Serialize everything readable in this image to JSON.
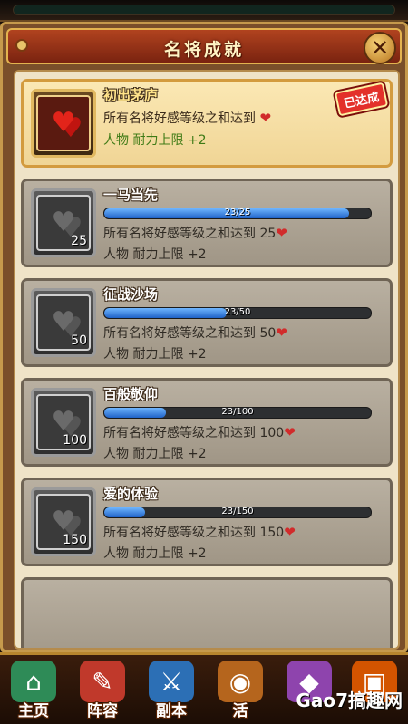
{
  "header": {
    "title": "名将成就",
    "close_label": "✕"
  },
  "achievements": [
    {
      "name": "初出茅庐",
      "desc": "所有名将好感等级之和达到",
      "target": "",
      "reward": "人物 耐力上限 +2",
      "status_stamp": "已达成",
      "progress_text": "",
      "progress": 1.0,
      "completed": true
    },
    {
      "name": "一马当先",
      "desc": "所有名将好感等级之和达到",
      "target": "25",
      "reward": "人物 耐力上限 +2",
      "progress_text": "23/25",
      "progress": 0.92,
      "badge_num": "25",
      "completed": false
    },
    {
      "name": "征战沙场",
      "desc": "所有名将好感等级之和达到",
      "target": "50",
      "reward": "人物 耐力上限 +2",
      "progress_text": "23/50",
      "progress": 0.46,
      "badge_num": "50",
      "completed": false
    },
    {
      "name": "百般敬仰",
      "desc": "所有名将好感等级之和达到",
      "target": "100",
      "reward": "人物 耐力上限 +2",
      "progress_text": "23/100",
      "progress": 0.23,
      "badge_num": "100",
      "completed": false
    },
    {
      "name": "爱的体验",
      "desc": "所有名将好感等级之和达到",
      "target": "150",
      "reward": "人物 耐力上限 +2",
      "progress_text": "23/150",
      "progress": 0.153,
      "badge_num": "150",
      "completed": false
    }
  ],
  "nav": [
    {
      "label": "主页",
      "icon": "home-icon",
      "color": "#2e8b57"
    },
    {
      "label": "阵容",
      "icon": "scroll-icon",
      "color": "#c0392b"
    },
    {
      "label": "副本",
      "icon": "sword-icon",
      "color": "#2c6fb5"
    },
    {
      "label": "活",
      "icon": "drum-icon",
      "color": "#b5651d"
    },
    {
      "label": "",
      "icon": "gem-icon",
      "color": "#8e44ad"
    },
    {
      "label": "",
      "icon": "chest-icon",
      "color": "#d35400"
    }
  ],
  "watermark": "Gao7搞趣网"
}
